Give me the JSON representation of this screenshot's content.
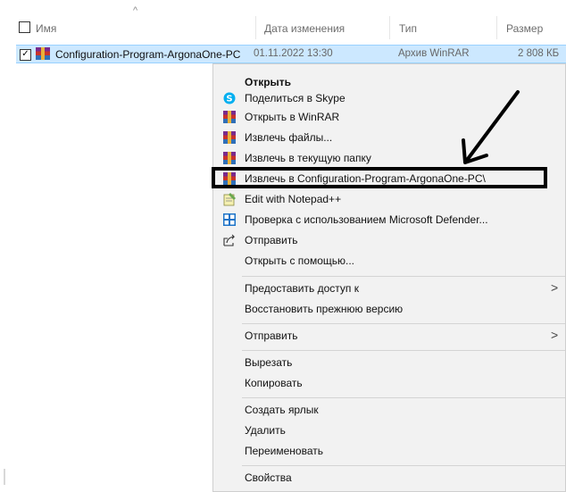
{
  "header": {
    "col_name": "Имя",
    "col_date": "Дата изменения",
    "col_type": "Тип",
    "col_size": "Размер",
    "sort_indicator": "^"
  },
  "file": {
    "name": "Configuration-Program-ArgonaOne-PC",
    "date": "01.11.2022 13:30",
    "type": "Архив WinRAR",
    "size": "2 808 КБ",
    "checked": "✓"
  },
  "menu": {
    "items": [
      {
        "label": "Открыть",
        "icon": "none"
      },
      {
        "label": "Поделиться в Skype",
        "icon": "skype-icon"
      },
      {
        "label": "Открыть в WinRAR",
        "icon": "winrar-icon"
      },
      {
        "label": "Извлечь файлы...",
        "icon": "winrar-icon"
      },
      {
        "label": "Извлечь в текущую папку",
        "icon": "winrar-icon"
      },
      {
        "label": "Извлечь в Configuration-Program-ArgonaOne-PC\\",
        "icon": "winrar-icon"
      },
      {
        "label": "Edit with Notepad++",
        "icon": "notepad-plus-plus-icon"
      },
      {
        "label": "Проверка с использованием Microsoft Defender...",
        "icon": "defender-icon"
      },
      {
        "label": "Отправить",
        "icon": "share-icon"
      },
      {
        "label": "Открыть с помощью...",
        "icon": "none"
      },
      {
        "label": "Предоставить доступ к",
        "icon": "none"
      },
      {
        "label": "Восстановить прежнюю версию",
        "icon": "none"
      },
      {
        "label": "Отправить",
        "icon": "none"
      },
      {
        "label": "Вырезать",
        "icon": "none"
      },
      {
        "label": "Копировать",
        "icon": "none"
      },
      {
        "label": "Создать ярлык",
        "icon": "none"
      },
      {
        "label": "Удалить",
        "icon": "none"
      },
      {
        "label": "Переименовать",
        "icon": "none"
      },
      {
        "label": "Свойства",
        "icon": "none"
      }
    ],
    "submenu_chevron": ">"
  },
  "colors": {
    "selection": "#cce8ff",
    "menu_bg": "#f2f2f2",
    "highlight_border": "#000000",
    "skype": "#00aff0",
    "defender": "#1e74c8"
  }
}
